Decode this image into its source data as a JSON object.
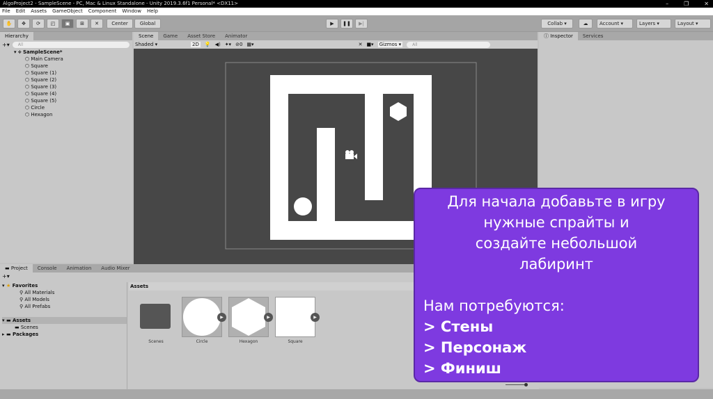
{
  "window": {
    "title": "AlgoProject2 - SampleScene - PC, Mac & Linux Standalone - Unity 2019.3.6f1 Personal* <DX11>",
    "controls": [
      "–",
      "❐",
      "✕"
    ]
  },
  "menu": [
    "File",
    "Edit",
    "Assets",
    "GameObject",
    "Component",
    "Window",
    "Help"
  ],
  "toolbar": {
    "center": "Center",
    "global": "Global",
    "collab": "Collab ▾",
    "account": "Account",
    "layers": "Layers",
    "layout": "Layout"
  },
  "hierarchy": {
    "tab": "Hierarchy",
    "search_placeholder": "All",
    "scene": "SampleScene*",
    "items": [
      "Main Camera",
      "Square",
      "Square (1)",
      "Square (2)",
      "Square (3)",
      "Square (4)",
      "Square (5)",
      "Circle",
      "Hexagon"
    ]
  },
  "scene": {
    "tabs": [
      "Scene",
      "Game",
      "Asset Store",
      "Animator"
    ],
    "shading": "Shaded",
    "mode2d": "2D",
    "hidden_count": "0",
    "gizmos": "Gizmos",
    "search_placeholder": "All"
  },
  "inspector": {
    "tabs": [
      "Inspector",
      "Services"
    ]
  },
  "project": {
    "tabs": [
      "Project",
      "Console",
      "Animation",
      "Audio Mixer"
    ],
    "favorites": "Favorites",
    "favorite_items": [
      "All Materials",
      "All Models",
      "All Prefabs"
    ],
    "assets": "Assets",
    "scenes": "Scenes",
    "packages": "Packages",
    "breadcrumb": "Assets",
    "items": [
      "Scenes",
      "Circle",
      "Hexagon",
      "Square"
    ]
  },
  "overlay": {
    "intro": [
      "Для начала добавьте в игру",
      "нужные спрайты и",
      "создайте небольшой",
      "лабиринт"
    ],
    "need": "Нам потребуются:",
    "list": [
      "> Стены",
      "> Персонаж",
      "> Финиш"
    ]
  },
  "colors": {
    "overlay": "#7e3ae0",
    "scene_bg": "#474747"
  }
}
